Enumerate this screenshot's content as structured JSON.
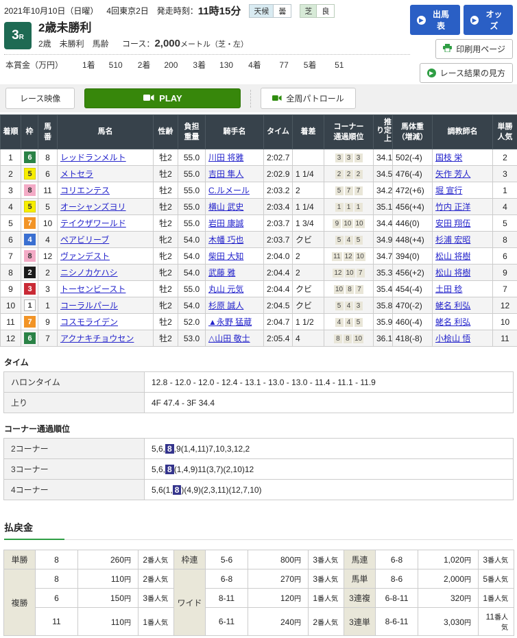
{
  "icons": {
    "arrow_right": "▶"
  },
  "header": {
    "date": "2021年10月10日（日曜）",
    "meeting": "4回東京2日",
    "start_label": "発走時刻：",
    "start_time": "11時15分",
    "weather_label": "天候",
    "weather_value": "曇",
    "turf_label": "芝",
    "turf_value": "良",
    "btn_shutsuba": "出馬表",
    "btn_odds": "オッズ",
    "btn_print": "印刷用ページ",
    "btn_guide": "レース結果の見方"
  },
  "race": {
    "number": "3",
    "number_suffix": "R",
    "title": "2歳未勝利",
    "conditions": "2歳　未勝利　馬齢",
    "course_label": "コース：",
    "course_value": "2,000",
    "course_unit": "メートル（芝・左）",
    "prize_label": "本賞金（万円）",
    "prizes": [
      {
        "place": "1着",
        "amount": "510"
      },
      {
        "place": "2着",
        "amount": "200"
      },
      {
        "place": "3着",
        "amount": "130"
      },
      {
        "place": "4着",
        "amount": "77"
      },
      {
        "place": "5着",
        "amount": "51"
      }
    ]
  },
  "video_bar": {
    "race_video": "レース映像",
    "play": "PLAY",
    "patrol": "全周パトロール"
  },
  "results": {
    "headers": [
      "着順",
      "枠",
      "馬\n番",
      "馬名",
      "性齢",
      "負担\n重量",
      "騎手名",
      "タイム",
      "着差",
      "コーナー\n通過順位",
      "推定上り",
      "馬体重\n（増減）",
      "調教師名",
      "単勝\n人気"
    ],
    "waku_colors": {
      "1": {
        "bg": "#ffffff",
        "fg": "#333333",
        "border": "#b5b5b5"
      },
      "2": {
        "bg": "#1a1a1a",
        "fg": "#ffffff",
        "border": "#1a1a1a"
      },
      "3": {
        "bg": "#c92a35",
        "fg": "#ffffff",
        "border": "#c92a35"
      },
      "4": {
        "bg": "#3a6fd1",
        "fg": "#ffffff",
        "border": "#3a6fd1"
      },
      "5": {
        "bg": "#f7ee00",
        "fg": "#333333",
        "border": "#d8cf00"
      },
      "6": {
        "bg": "#2a8246",
        "fg": "#ffffff",
        "border": "#2a8246"
      },
      "7": {
        "bg": "#f29426",
        "fg": "#ffffff",
        "border": "#f29426"
      },
      "8": {
        "bg": "#f3abc6",
        "fg": "#333333",
        "border": "#f3abc6"
      }
    },
    "rows": [
      {
        "order": "1",
        "waku": "6",
        "num": "8",
        "name": "レッドランメルト",
        "sex_age": "牡2",
        "weight": "55.0",
        "jockey": "川田 将雅",
        "time": "2:02.7",
        "margin": "",
        "corners": [
          "3",
          "3",
          "3"
        ],
        "agari": "34.1",
        "horse_weight": "502(-4)",
        "trainer": "国枝 栄",
        "pop": "2"
      },
      {
        "order": "2",
        "waku": "5",
        "num": "6",
        "name": "メトセラ",
        "sex_age": "牡2",
        "weight": "55.0",
        "jockey": "吉田 隼人",
        "time": "2:02.9",
        "margin": "1 1/4",
        "corners": [
          "2",
          "2",
          "2"
        ],
        "agari": "34.5",
        "horse_weight": "476(-4)",
        "trainer": "矢作 芳人",
        "pop": "3"
      },
      {
        "order": "3",
        "waku": "8",
        "num": "11",
        "name": "コリエンテス",
        "sex_age": "牡2",
        "weight": "55.0",
        "jockey": "C.ルメール",
        "time": "2:03.2",
        "margin": "2",
        "corners": [
          "5",
          "7",
          "7"
        ],
        "agari": "34.2",
        "horse_weight": "472(+6)",
        "trainer": "堀 宣行",
        "pop": "1"
      },
      {
        "order": "4",
        "waku": "5",
        "num": "5",
        "name": "オーシャンズヨリ",
        "sex_age": "牡2",
        "weight": "55.0",
        "jockey": "横山 武史",
        "time": "2:03.4",
        "margin": "1 1/4",
        "corners": [
          "1",
          "1",
          "1"
        ],
        "agari": "35.1",
        "horse_weight": "456(+4)",
        "trainer": "竹内 正洋",
        "pop": "4"
      },
      {
        "order": "5",
        "waku": "7",
        "num": "10",
        "name": "テイクザワールド",
        "sex_age": "牡2",
        "weight": "55.0",
        "jockey": "岩田 康誠",
        "time": "2:03.7",
        "margin": "1 3/4",
        "corners": [
          "9",
          "10",
          "10"
        ],
        "agari": "34.4",
        "horse_weight": "446(0)",
        "trainer": "安田 翔伍",
        "pop": "5"
      },
      {
        "order": "6",
        "waku": "4",
        "num": "4",
        "name": "ペアビリーブ",
        "sex_age": "牝2",
        "weight": "54.0",
        "jockey": "木幡 巧也",
        "time": "2:03.7",
        "margin": "クビ",
        "corners": [
          "5",
          "4",
          "5"
        ],
        "agari": "34.9",
        "horse_weight": "448(+4)",
        "trainer": "杉浦 宏昭",
        "pop": "8"
      },
      {
        "order": "7",
        "waku": "8",
        "num": "12",
        "name": "ヴァンデスト",
        "sex_age": "牝2",
        "weight": "54.0",
        "jockey": "柴田 大知",
        "time": "2:04.0",
        "margin": "2",
        "corners": [
          "11",
          "12",
          "10"
        ],
        "agari": "34.7",
        "horse_weight": "394(0)",
        "trainer": "松山 将樹",
        "pop": "6"
      },
      {
        "order": "8",
        "waku": "2",
        "num": "2",
        "name": "ニシノカケハシ",
        "sex_age": "牝2",
        "weight": "54.0",
        "jockey": "武藤 雅",
        "time": "2:04.4",
        "margin": "2",
        "corners": [
          "12",
          "10",
          "7"
        ],
        "agari": "35.3",
        "horse_weight": "456(+2)",
        "trainer": "松山 将樹",
        "pop": "9"
      },
      {
        "order": "9",
        "waku": "3",
        "num": "3",
        "name": "トーセンビースト",
        "sex_age": "牡2",
        "weight": "55.0",
        "jockey": "丸山 元気",
        "time": "2:04.4",
        "margin": "クビ",
        "corners": [
          "10",
          "8",
          "7"
        ],
        "agari": "35.4",
        "horse_weight": "454(-4)",
        "trainer": "土田 稔",
        "pop": "7"
      },
      {
        "order": "10",
        "waku": "1",
        "num": "1",
        "name": "コーラルパール",
        "sex_age": "牝2",
        "weight": "54.0",
        "jockey": "杉原 誠人",
        "time": "2:04.5",
        "margin": "クビ",
        "corners": [
          "5",
          "4",
          "3"
        ],
        "agari": "35.8",
        "horse_weight": "470(-2)",
        "trainer": "蛯名 利弘",
        "pop": "12"
      },
      {
        "order": "11",
        "waku": "7",
        "num": "9",
        "name": "コスモライデン",
        "sex_age": "牡2",
        "weight": "52.0",
        "jockey": "▲永野 猛蔵",
        "time": "2:04.7",
        "margin": "1 1/2",
        "corners": [
          "4",
          "4",
          "5"
        ],
        "agari": "35.9",
        "horse_weight": "460(-4)",
        "trainer": "蛯名 利弘",
        "pop": "10"
      },
      {
        "order": "12",
        "waku": "6",
        "num": "7",
        "name": "アクナキチョウセン",
        "sex_age": "牡2",
        "weight": "53.0",
        "jockey": "△山田 敬士",
        "time": "2:05.4",
        "margin": "4",
        "corners": [
          "8",
          "8",
          "10"
        ],
        "agari": "36.1",
        "horse_weight": "418(-8)",
        "trainer": "小桧山 悟",
        "pop": "11"
      }
    ]
  },
  "time_section": {
    "title": "タイム",
    "rows": [
      {
        "label": "ハロンタイム",
        "value": "12.8 - 12.0 - 12.0 - 12.4 - 13.1 - 13.0 - 13.0 - 11.4 - 11.1 - 11.9"
      },
      {
        "label": "上り",
        "value": "4F 47.4 - 3F 34.4"
      }
    ]
  },
  "corner_section": {
    "title": "コーナー通過順位",
    "rows": [
      {
        "label": "2コーナー",
        "pre": "5,6,",
        "hl": "8",
        "post": ",9(1,4,11)7,10,3,12,2"
      },
      {
        "label": "3コーナー",
        "pre": "5,6,",
        "hl": "8",
        "post": "(1,4,9)11(3,7)(2,10)12"
      },
      {
        "label": "4コーナー",
        "pre": "5,6(1,",
        "hl": "8",
        "post": ")(4,9)(2,3,11)(12,7,10)"
      }
    ]
  },
  "payout": {
    "title": "払戻金",
    "yen": "円",
    "pop_suffix": "番人気",
    "tansho": {
      "label": "単勝",
      "rows": [
        {
          "combo": "8",
          "amount": "260",
          "pop": "2"
        }
      ]
    },
    "fukusho": {
      "label": "複勝",
      "rows": [
        {
          "combo": "8",
          "amount": "110",
          "pop": "2"
        },
        {
          "combo": "6",
          "amount": "150",
          "pop": "3"
        },
        {
          "combo": "11",
          "amount": "110",
          "pop": "1"
        }
      ]
    },
    "wakuren": {
      "label": "枠連",
      "rows": [
        {
          "combo": "5-6",
          "amount": "800",
          "pop": "3"
        }
      ]
    },
    "wide": {
      "label": "ワイド",
      "rows": [
        {
          "combo": "6-8",
          "amount": "270",
          "pop": "3"
        },
        {
          "combo": "8-11",
          "amount": "120",
          "pop": "1"
        },
        {
          "combo": "6-11",
          "amount": "240",
          "pop": "2"
        }
      ]
    },
    "umaren": {
      "label": "馬連",
      "rows": [
        {
          "combo": "6-8",
          "amount": "1,020",
          "pop": "3"
        }
      ]
    },
    "umatan": {
      "label": "馬単",
      "rows": [
        {
          "combo": "8-6",
          "amount": "2,000",
          "pop": "5"
        }
      ]
    },
    "sanrenpuku": {
      "label": "3連複",
      "rows": [
        {
          "combo": "6-8-11",
          "amount": "320",
          "pop": "1"
        }
      ]
    },
    "sanrentan": {
      "label": "3連単",
      "rows": [
        {
          "combo": "8-6-11",
          "amount": "3,030",
          "pop": "11"
        }
      ]
    }
  }
}
